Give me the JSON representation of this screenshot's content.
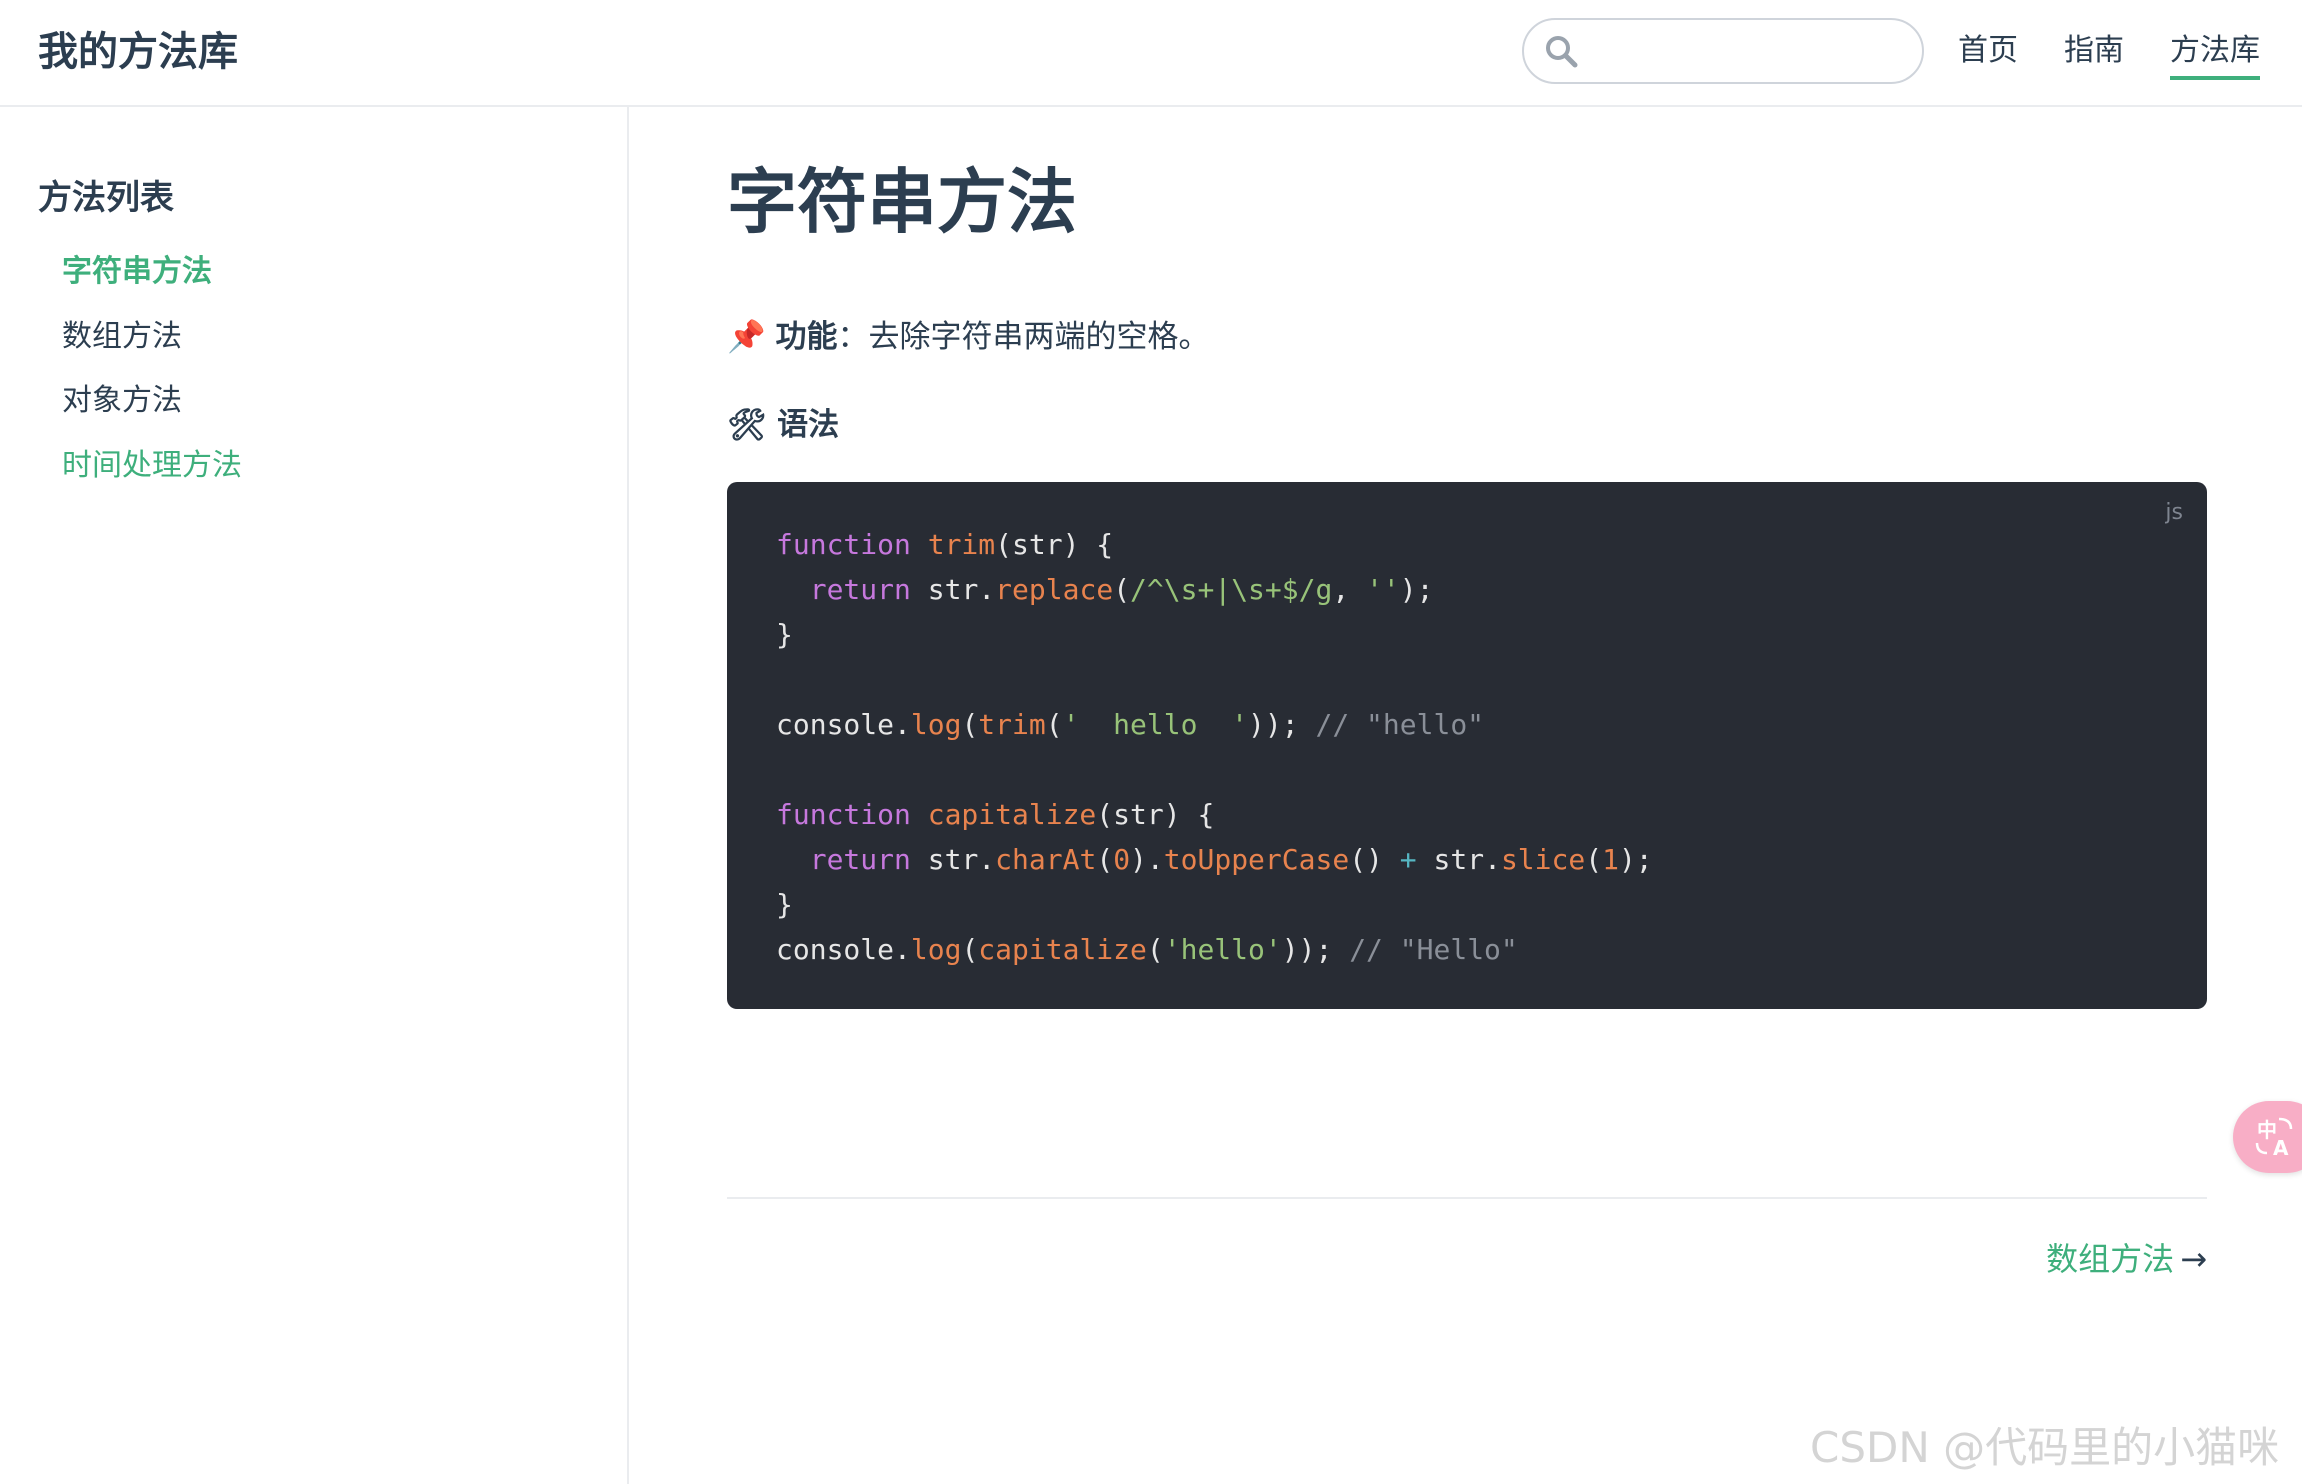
{
  "navbar": {
    "site_name": "我的方法库",
    "search": {
      "placeholder": "",
      "value": ""
    },
    "links": [
      {
        "label": "首页",
        "active": false
      },
      {
        "label": "指南",
        "active": false
      },
      {
        "label": "方法库",
        "active": true
      }
    ]
  },
  "sidebar": {
    "heading": "方法列表",
    "items": [
      {
        "label": "字符串方法",
        "state": "active"
      },
      {
        "label": "数组方法",
        "state": "normal"
      },
      {
        "label": "对象方法",
        "state": "normal"
      },
      {
        "label": "时间处理方法",
        "state": "link"
      }
    ]
  },
  "main": {
    "title": "字符串方法",
    "feature": {
      "icon": "📌",
      "label": "功能",
      "separator": "：",
      "text": "去除字符串两端的空格。"
    },
    "syntax": {
      "icon": "🛠",
      "label": "语法"
    },
    "code": {
      "lang": "js",
      "lines": [
        "function trim(str) {",
        "  return str.replace(/^\\s+|\\s+$/g, '');",
        "}",
        "",
        "console.log(trim('  hello  ')); // \"hello\"",
        "",
        "function capitalize(str) {",
        "  return str.charAt(0).toUpperCase() + str.slice(1);",
        "}",
        "console.log(capitalize('hello')); // \"Hello\""
      ]
    },
    "next_link": {
      "label": "数组方法",
      "arrow": "→"
    }
  },
  "translate_button": {
    "icon": "translate-icon"
  },
  "watermark": "CSDN @代码里的小猫咪",
  "colors": {
    "accent": "#3eaf7c",
    "text": "#2c3e50",
    "code_bg": "#282c34",
    "translate_bg": "#f8aec6"
  }
}
